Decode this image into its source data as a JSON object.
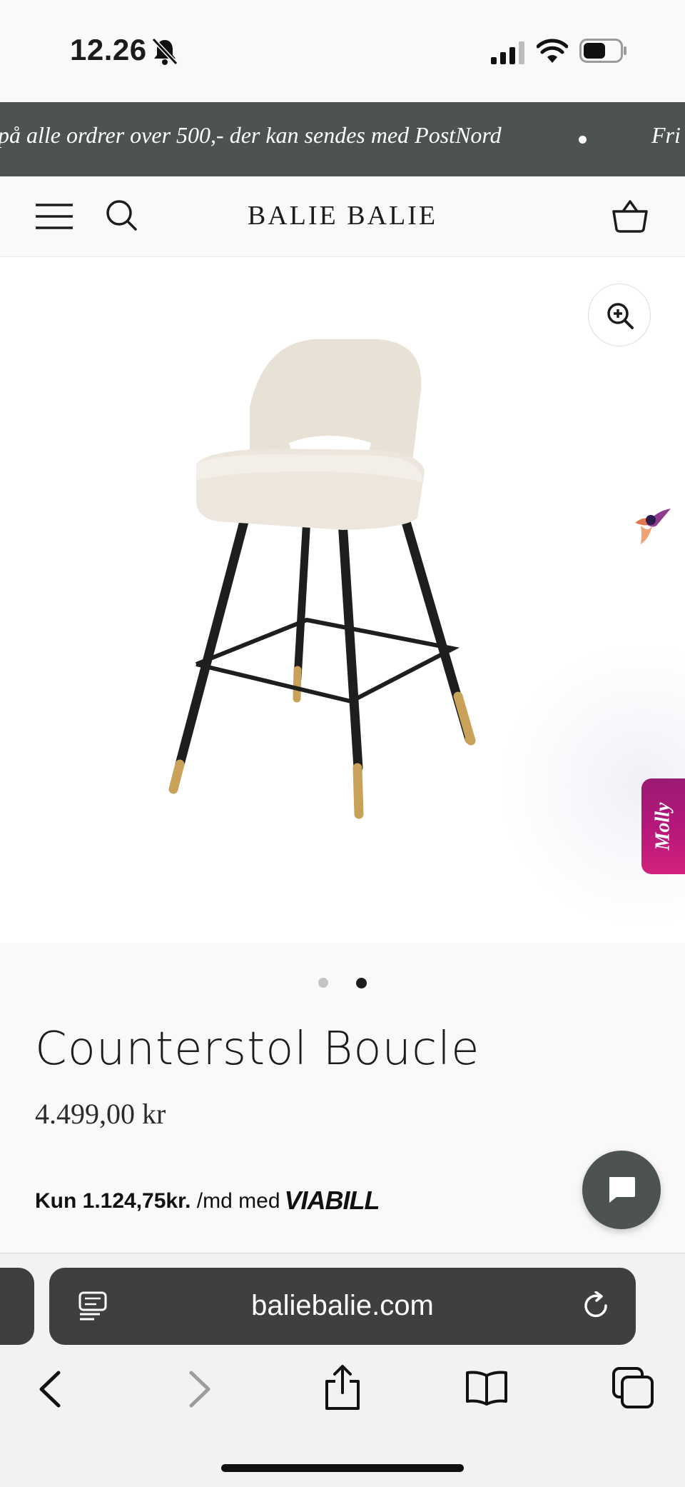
{
  "status_bar": {
    "time": "12.26"
  },
  "announcement": {
    "text": "på alle ordrer over 500,- der kan sendes med PostNord",
    "text_next": "Fri",
    "background": "#4c5352"
  },
  "header": {
    "brand": "BALIE BALIE"
  },
  "gallery": {
    "slide_count": 2,
    "active_slide": 2
  },
  "molly": {
    "label": "Molly"
  },
  "product": {
    "title": "Counterstol Boucle",
    "price": "4.499,00 kr",
    "financing": {
      "prefix": "Kun 1.124,75kr.",
      "suffix": " /md med",
      "provider": "VIABILL"
    }
  },
  "browser": {
    "url": "baliebalie.com"
  },
  "colors": {
    "accent": "#4c5352",
    "molly": "#b5177a"
  },
  "icons": [
    "bell-off-icon",
    "signal-icon",
    "wifi-icon",
    "battery-icon",
    "menu-icon",
    "search-icon",
    "cart-icon",
    "zoom-in-icon",
    "hummingbird-icon",
    "chat-icon",
    "reader-icon",
    "reload-icon",
    "back-icon",
    "forward-icon",
    "share-icon",
    "bookmarks-icon",
    "tabs-icon"
  ]
}
